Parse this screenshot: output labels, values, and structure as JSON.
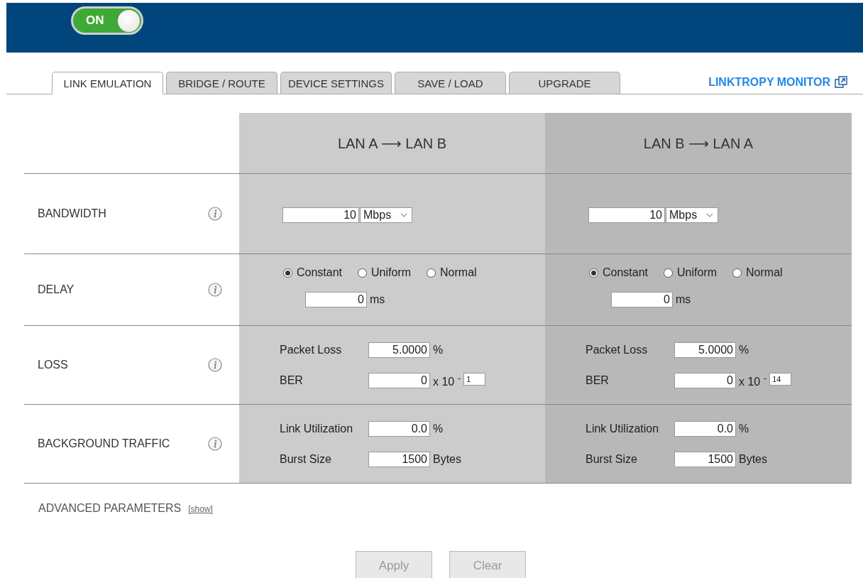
{
  "power_toggle": {
    "label": "ON",
    "on": true
  },
  "tabs": [
    {
      "label": "LINK EMULATION",
      "selected": true
    },
    {
      "label": "BRIDGE / ROUTE",
      "selected": false
    },
    {
      "label": "DEVICE SETTINGS",
      "selected": false
    },
    {
      "label": "SAVE / LOAD",
      "selected": false
    },
    {
      "label": "UPGRADE",
      "selected": false
    }
  ],
  "monitor_link": "LINKTROPY MONITOR",
  "row_labels": [
    "BANDWIDTH",
    "DELAY",
    "LOSS",
    "BACKGROUND TRAFFIC"
  ],
  "directions": [
    {
      "title": "LAN A ⟶ LAN B",
      "bandwidth": {
        "value": "10",
        "unit": "Mbps"
      },
      "delay": {
        "distributions": [
          {
            "label": "Constant",
            "selected": true
          },
          {
            "label": "Uniform",
            "selected": false
          },
          {
            "label": "Normal",
            "selected": false
          }
        ],
        "value": "0",
        "unit": "ms"
      },
      "loss": {
        "packet_loss_label": "Packet Loss",
        "packet_loss": "5.0000",
        "packet_loss_unit": "%",
        "ber_label": "BER",
        "ber": "0",
        "ber_multiplier": "x 10 $^{-}$",
        "ber_exponent": "1"
      },
      "traffic": {
        "utilization_label": "Link Utilization",
        "utilization": "0.0",
        "utilization_unit": "%",
        "burst_label": "Burst Size",
        "burst": "1500",
        "burst_unit": "Bytes"
      }
    },
    {
      "title": "LAN B ⟶ LAN A",
      "bandwidth": {
        "value": "10",
        "unit": "Mbps"
      },
      "delay": {
        "distributions": [
          {
            "label": "Constant",
            "selected": true
          },
          {
            "label": "Uniform",
            "selected": false
          },
          {
            "label": "Normal",
            "selected": false
          }
        ],
        "value": "0",
        "unit": "ms"
      },
      "loss": {
        "packet_loss_label": "Packet Loss",
        "packet_loss": "5.0000",
        "packet_loss_unit": "%",
        "ber_label": "BER",
        "ber": "0",
        "ber_multiplier": "x 10 $^{-}$",
        "ber_exponent": "14"
      },
      "traffic": {
        "utilization_label": "Link Utilization",
        "utilization": "0.0",
        "utilization_unit": "%",
        "burst_label": "Burst Size",
        "burst": "1500",
        "burst_unit": "Bytes"
      }
    }
  ],
  "advanced": {
    "label": "ADVANCED PARAMETERS",
    "toggle": "[show]"
  },
  "buttons": [
    {
      "label": "Apply",
      "disabled": true
    },
    {
      "label": "Clear",
      "disabled": true
    }
  ]
}
